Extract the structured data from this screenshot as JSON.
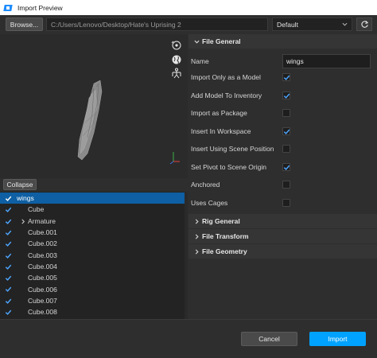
{
  "window": {
    "title": "Import Preview"
  },
  "toolbar": {
    "browse_label": "Browse...",
    "path_value": "C:/Users/Lenovo/Desktop/Hate's Uprising 2",
    "preset_value": "Default"
  },
  "tree": {
    "collapse_label": "Collapse",
    "items": [
      {
        "label": "wings",
        "checked": true,
        "selected": true
      },
      {
        "label": "Cube",
        "checked": true
      },
      {
        "label": "Armature",
        "checked": true,
        "expandable": true
      },
      {
        "label": "Cube.001",
        "checked": true
      },
      {
        "label": "Cube.002",
        "checked": true
      },
      {
        "label": "Cube.003",
        "checked": true
      },
      {
        "label": "Cube.004",
        "checked": true
      },
      {
        "label": "Cube.005",
        "checked": true
      },
      {
        "label": "Cube.006",
        "checked": true
      },
      {
        "label": "Cube.007",
        "checked": true
      },
      {
        "label": "Cube.008",
        "checked": true
      }
    ]
  },
  "properties": {
    "file_general": {
      "header": "File General",
      "name_label": "Name",
      "name_value": "wings",
      "options": [
        {
          "label": "Import Only as a Model",
          "checked": true
        },
        {
          "label": "Add Model To Inventory",
          "checked": true
        },
        {
          "label": "Import as Package",
          "checked": false
        },
        {
          "label": "Insert In Workspace",
          "checked": true
        },
        {
          "label": "Insert Using Scene Position",
          "checked": false
        },
        {
          "label": "Set Pivot to Scene Origin",
          "checked": true
        },
        {
          "label": "Anchored",
          "checked": false
        },
        {
          "label": "Uses Cages",
          "checked": false
        }
      ]
    },
    "sections": [
      {
        "header": "Rig General"
      },
      {
        "header": "File Transform"
      },
      {
        "header": "File Geometry"
      }
    ]
  },
  "footer": {
    "cancel_label": "Cancel",
    "import_label": "Import"
  },
  "colors": {
    "accent": "#00a2ff",
    "selection": "#0e5fa3",
    "check": "#4ea6ff"
  }
}
